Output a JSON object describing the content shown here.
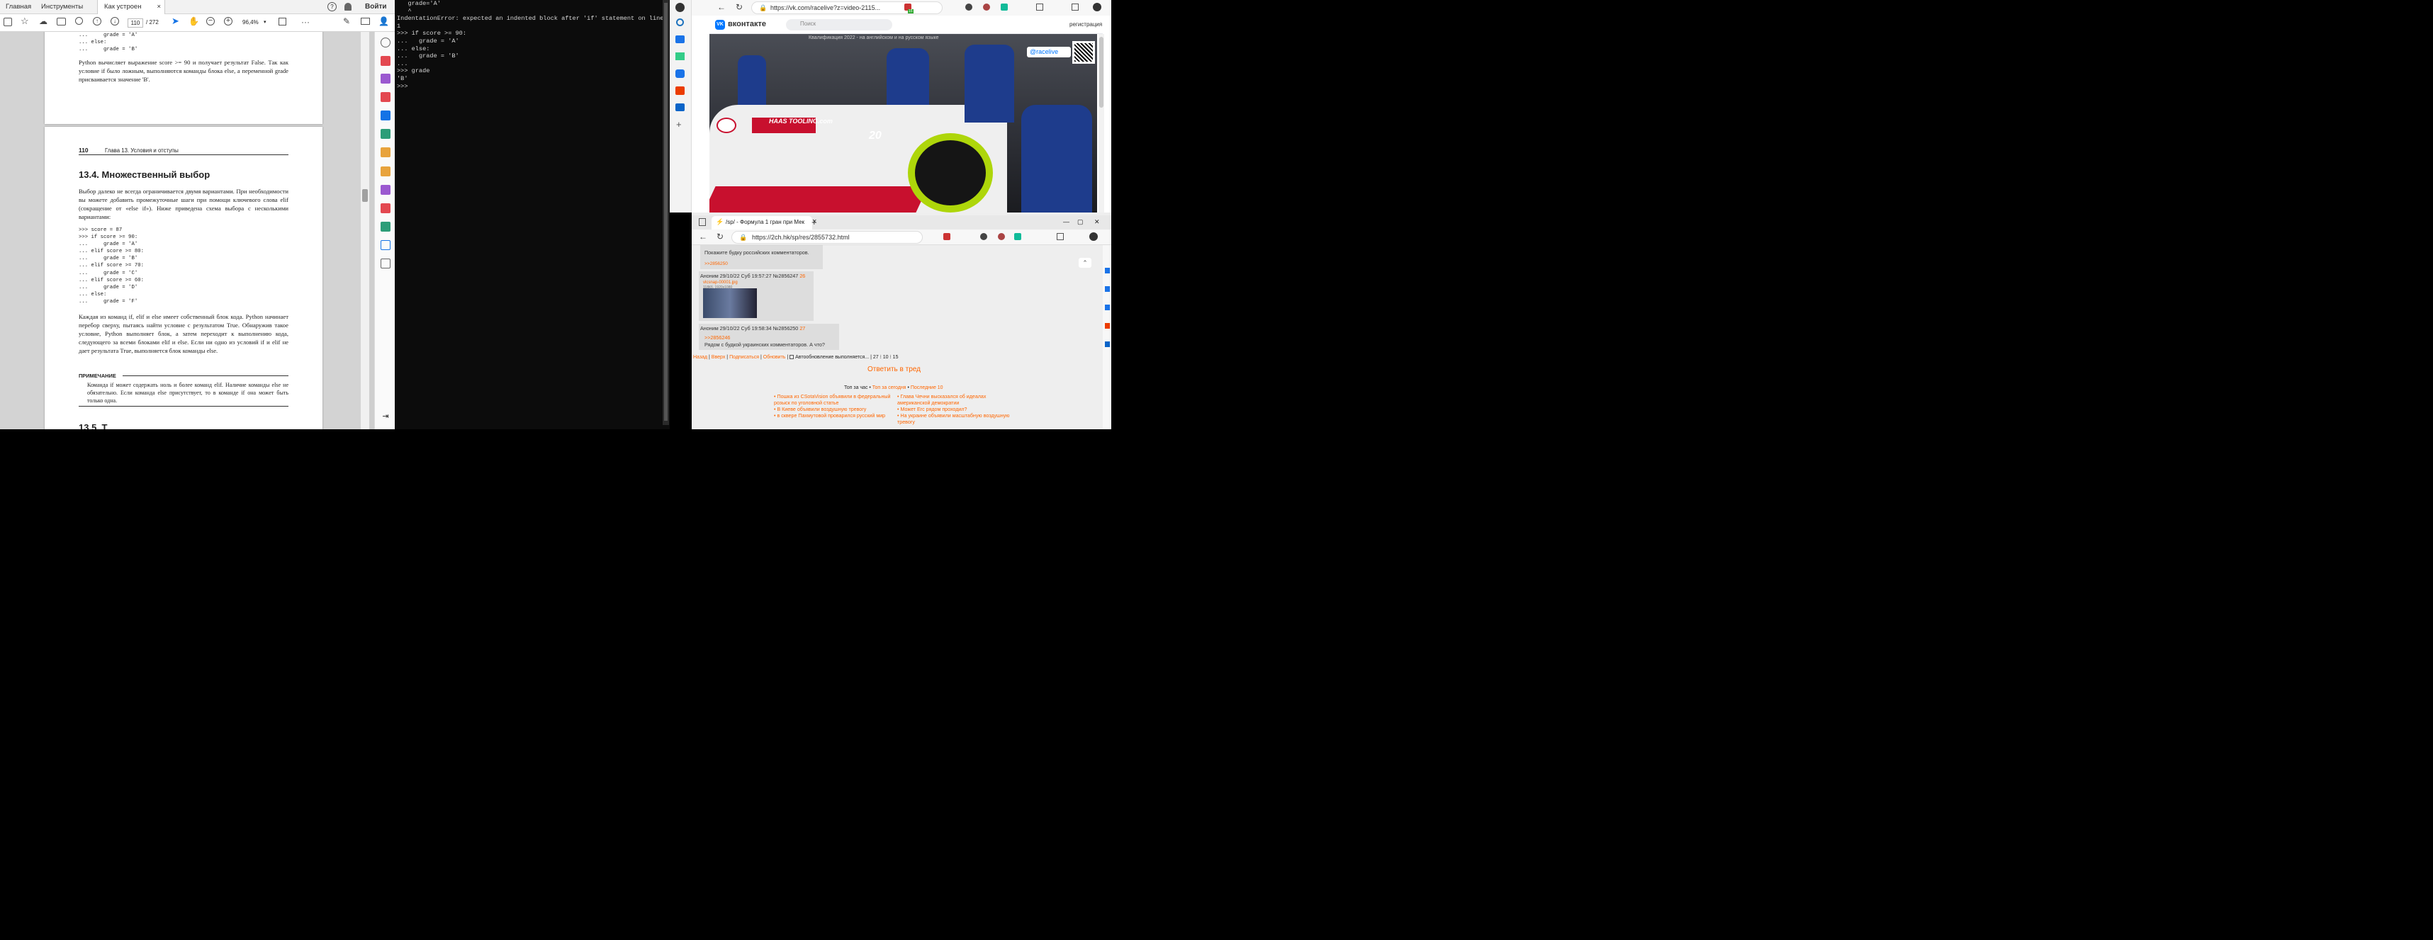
{
  "pdf": {
    "tabs": [
      "Главная",
      "Инструменты",
      "Как устроен Pytho..."
    ],
    "close_glyph": "×",
    "help_glyph": "?",
    "signin": "Войти",
    "page_current": "110",
    "page_total": "/ 272",
    "zoom": "96,4%",
    "page1": {
      "code_top": ">>> if score >= 90:\n...     grade = 'A'\n... else:\n...     grade = 'B'",
      "para": "Python вычисляет выражение score >= 90 и получает результат False. Так как условие if было ложным, выполняются команды блока else, а переменной grade присваивается значение 'B'."
    },
    "page2": {
      "header_num": "110",
      "header_text": "Глава 13. Условия и отступы",
      "heading": "13.4. Множественный выбор",
      "para1": "Выбор далеко не всегда ограничивается двумя вариантами. При необходимости вы можете добавить промежуточные шаги при помощи ключевого слова elif (сокращение от «else if»). Ниже приведена схема выбора с несколькими вариантами:",
      "code": ">>> score = 87\n>>> if score >= 90:\n...     grade = 'A'\n... elif score >= 80:\n...     grade = 'B'\n... elif score >= 70:\n...     grade = 'C'\n... elif score >= 60:\n...     grade = 'D'\n... else:\n...     grade = 'F'",
      "para2": "Каждая из команд if, elif и else имеет собственный блок кода. Python начинает перебор сверху, пытаясь найти условие с результатом True. Обнаружив такое условие, Python выполняет блок, а затем переходит к выполнению кода, следующего за всеми блоками elif и else. Если ни одно из условий if и elif не дает результата True, выполняется блок команды else.",
      "note_title": "ПРИМЕЧАНИЕ",
      "note_text": "Команда if может содержать ноль и более команд elif. Наличие команды else не обязательно. Если команда else присутствует, то в команде if она может быть только одна.",
      "next_heading": "13.5. Т..."
    }
  },
  "terminal": {
    "text": "   grade='A'\n   ^\nIndentationError: expected an indented block after 'if' statement on line\n1\n>>> if score >= 90:\n...   grade = 'A'\n... else:\n...   grade = 'B'\n...\n>>> grade\n'B'\n>>>"
  },
  "vk_browser": {
    "url": "https://vk.com/racelive?z=video-2115...",
    "logo": "вконтакте",
    "search_placeholder": "Поиск",
    "register": "регистрация",
    "caption": "Квалификация 2022 - на английском и на русском языке",
    "watermark": "@racelive",
    "car_brand": "HAAS TOOLING.com",
    "car_number": "20",
    "badge": "15"
  },
  "ch_browser": {
    "tab_title": "/sp/ - Формула 1 гран при Мек",
    "url": "https://2ch.hk/sp/res/2855732.html",
    "window_controls": [
      "—",
      "▢",
      "✕"
    ],
    "back_to_top_glyph": "⌃",
    "post0": {
      "text": "Покажите будку российских комментаторов.",
      "reply": ">>2856250"
    },
    "post1": {
      "header": "Аноним 29/10/22 Суб 19:57:27 №2856247",
      "num": "26",
      "file": "vlcsnap-00001.jpg",
      "file_meta": "118Кб, 1920x1080"
    },
    "post2": {
      "header": "Аноним 29/10/22 Суб 19:58:34 №2856250",
      "num": "27",
      "reply": ">>2856246",
      "text": "Рядом с будкой украинских комментаторов. А что?"
    },
    "nav": [
      "Назад",
      "Вверх",
      "Подписаться",
      "Обновить"
    ],
    "separator": "|",
    "autoupdate": "Автообновление выполняется...",
    "stats": "27 ⁝ 10 ⁝ 15",
    "reply_button": "Ответить в тред",
    "top_label": "Топ за час •",
    "top_day": "Топ за сегодня",
    "top_sep": "•",
    "top_latest": "Последние 10",
    "bullet": "•",
    "top_items_left": [
      "Пошка из CSotaVision объявили в федеральный розыск по уголовной статье",
      "В Киеве объявили воздушную тревогу",
      "в сквере Пахмутовой проварился русский мир"
    ],
    "top_items_right": [
      "Глава Чечни высказался об идеалах американской демократии",
      "Может Егс рядом проходил?",
      "На украине объявили масштабную воздушную тревогу"
    ]
  }
}
